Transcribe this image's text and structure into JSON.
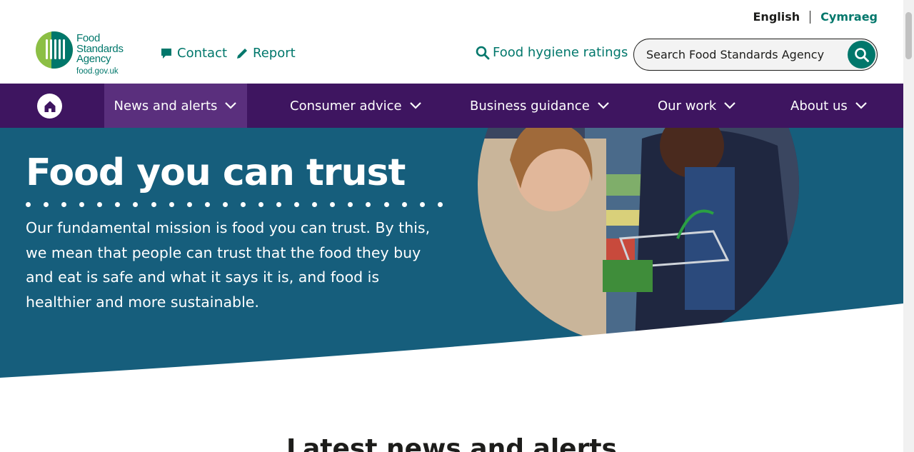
{
  "language": {
    "english": "English",
    "welsh": "Cymraeg"
  },
  "logo": {
    "line1": "Food",
    "line2": "Standards",
    "line3": "Agency",
    "url": "food.gov.uk"
  },
  "utility": {
    "contact": "Contact",
    "report": "Report",
    "food_hygiene": "Food hygiene ratings"
  },
  "search": {
    "placeholder": "Search Food Standards Agency"
  },
  "nav": {
    "items": [
      {
        "label": "News and alerts"
      },
      {
        "label": "Consumer advice"
      },
      {
        "label": "Business guidance"
      },
      {
        "label": "Our work"
      },
      {
        "label": "About us"
      }
    ]
  },
  "hero": {
    "title": "Food you can trust",
    "body": "Our fundamental mission is food you can trust. By this, we mean that people can trust that the food they buy and eat is safe and what it says it is, and food is healthier and more sustainable."
  },
  "section": {
    "heading": "Latest news and alerts"
  },
  "colors": {
    "brand_green": "#00776b",
    "nav_purple": "#3e1560",
    "hero_teal": "#165e7c"
  }
}
